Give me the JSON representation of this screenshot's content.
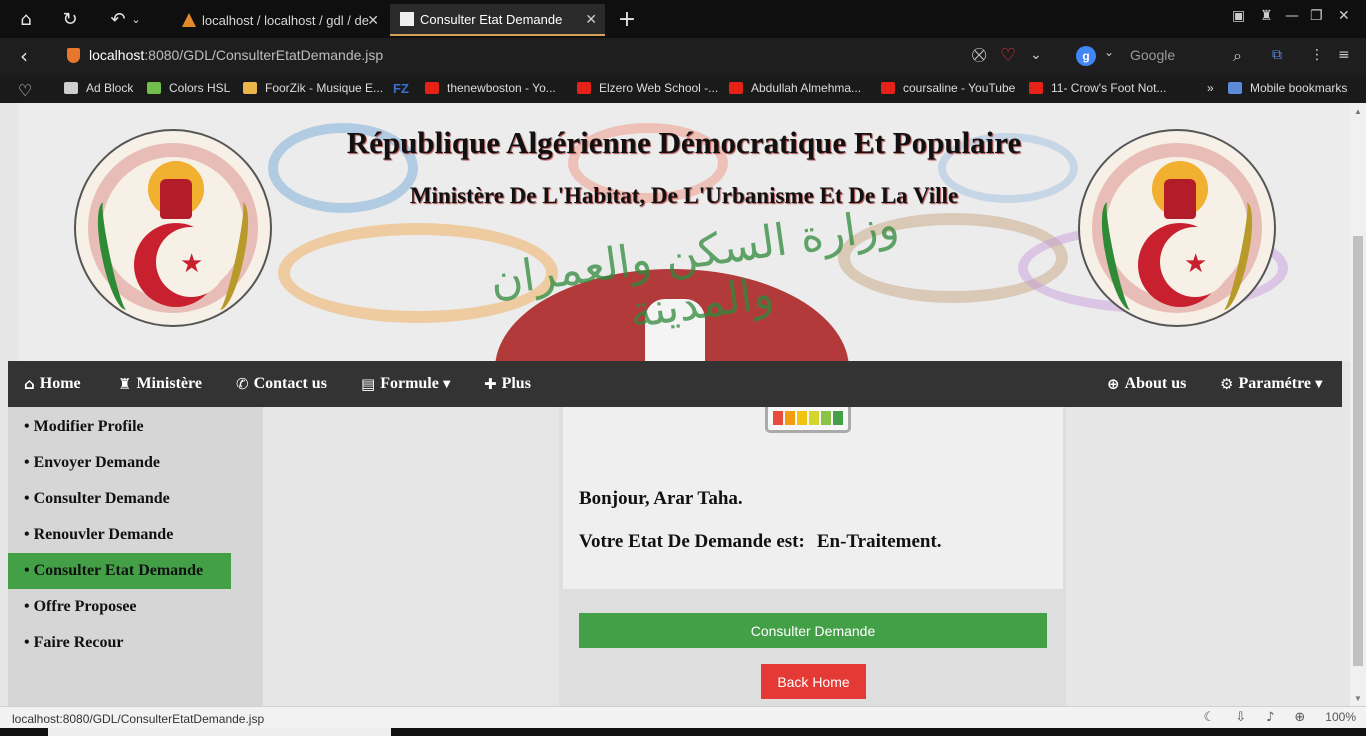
{
  "browser": {
    "tabs": [
      {
        "title": "localhost / localhost / gdl / de",
        "active": false
      },
      {
        "title": "Consulter Etat Demande",
        "active": true
      }
    ],
    "url_host": "localhost",
    "url_path": ":8080/GDL/ConsulterEtatDemande.jsp",
    "search_placeholder": "Google",
    "search_engine_letter": "g",
    "bookmarks": [
      {
        "label": "Ad Block",
        "color": "#cfcfcf"
      },
      {
        "label": "Colors HSL",
        "color": "#6fbf4a"
      },
      {
        "label": "FoorZik - Musique E...",
        "color": "#e8b64a"
      },
      {
        "label": "FZ",
        "color": "#3b6fd0"
      },
      {
        "label": "thenewboston - Yo...",
        "color": "#e62117"
      },
      {
        "label": "Elzero Web School -...",
        "color": "#e62117"
      },
      {
        "label": "Abdullah Almehma...",
        "color": "#e62117"
      },
      {
        "label": "coursaline - YouTube",
        "color": "#e62117"
      },
      {
        "label": "11- Crow's Foot Not...",
        "color": "#e62117"
      }
    ],
    "bookmarks_more": "»",
    "mobile_bookmarks": "Mobile bookmarks",
    "status_url": "localhost:8080/GDL/ConsulterEtatDemande.jsp",
    "zoom": "100%"
  },
  "header": {
    "title": "République Algérienne Démocratique Et Populaire",
    "subtitle": "Ministère De L'Habitat, De L'Urbanisme Et De La Ville",
    "arabic": "وزارة السكن والعمران والمدينة"
  },
  "nav": {
    "home": "Home",
    "ministere": "Ministère",
    "contact": "Contact us",
    "formule": "Formule",
    "plus": "Plus",
    "about": "About us",
    "parametre": "Paramétre"
  },
  "sidebar": {
    "items": [
      {
        "label": "• Modifier Profile",
        "active": false
      },
      {
        "label": "• Envoyer Demande",
        "active": false
      },
      {
        "label": "• Consulter Demande",
        "active": false
      },
      {
        "label": "• Renouvler Demande",
        "active": false
      },
      {
        "label": "• Consulter Etat Demande",
        "active": true
      },
      {
        "label": "• Offre Proposee",
        "active": false
      },
      {
        "label": "• Faire Recour",
        "active": false
      }
    ]
  },
  "main": {
    "greeting": "Bonjour, Arar Taha.",
    "state_label": "Votre Etat De Demande est:",
    "state_value": "En-Traitement.",
    "consult_button": "Consulter Demande",
    "back_button": "Back Home",
    "gauge_colors": [
      "#e74c3c",
      "#f39c12",
      "#f1c40f",
      "#d4d72b",
      "#8bc34a",
      "#43a047"
    ]
  },
  "colors": {
    "accent_green": "#43a047",
    "back_red": "#e53935",
    "nav_bg": "#333333"
  }
}
